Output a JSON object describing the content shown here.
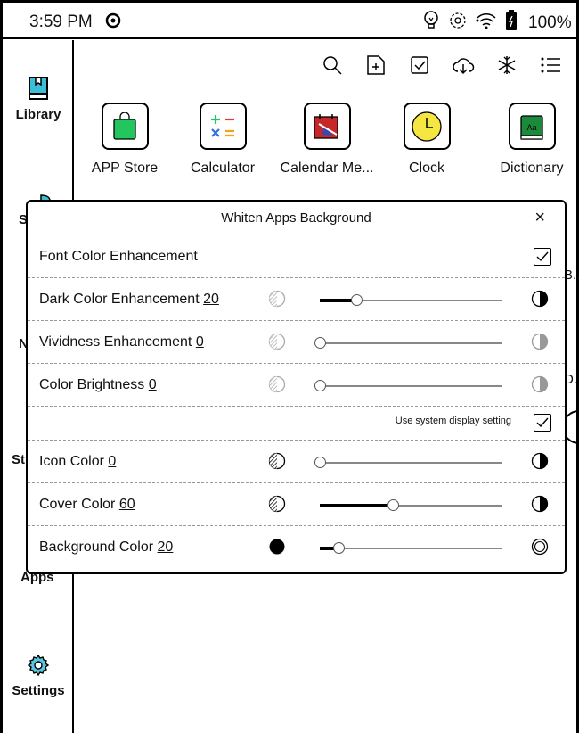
{
  "status_bar": {
    "time": "3:59 PM",
    "battery": "100%"
  },
  "sidebar": {
    "items": [
      {
        "label": "Library"
      },
      {
        "label": "S"
      },
      {
        "label": "N"
      },
      {
        "label": "St"
      },
      {
        "label": "Apps"
      },
      {
        "label": "Settings"
      }
    ]
  },
  "apps": [
    {
      "label": "APP Store",
      "color": "#22c55e"
    },
    {
      "label": "Calculator"
    },
    {
      "label": "Calendar Me...",
      "color": "#c62828"
    },
    {
      "label": "Clock",
      "color": "#f5e642"
    },
    {
      "label": "Dictionary",
      "color": "#1b8a3a",
      "glyph": "Aa"
    }
  ],
  "edge_fragments": [
    "B..",
    "D..."
  ],
  "dialog": {
    "title": "Whiten Apps Background",
    "close_glyph": "×",
    "font_color": {
      "label": "Font Color Enhancement",
      "checked": true
    },
    "sliders_top": [
      {
        "label": "Dark Color Enhancement",
        "value": "20",
        "level": 0.2,
        "enabled": true
      },
      {
        "label": "Vividness Enhancement",
        "value": "0",
        "level": 0.0,
        "enabled": false
      },
      {
        "label": "Color Brightness",
        "value": "0",
        "level": 0.0,
        "enabled": false
      }
    ],
    "system_setting": {
      "label": "Use system display setting",
      "checked": true
    },
    "sliders_bottom": [
      {
        "label": "Icon Color",
        "value": "0",
        "level": 0.0
      },
      {
        "label": "Cover Color",
        "value": "60",
        "level": 0.4
      },
      {
        "label": "Background Color",
        "value": "20",
        "level": 0.1
      }
    ]
  }
}
